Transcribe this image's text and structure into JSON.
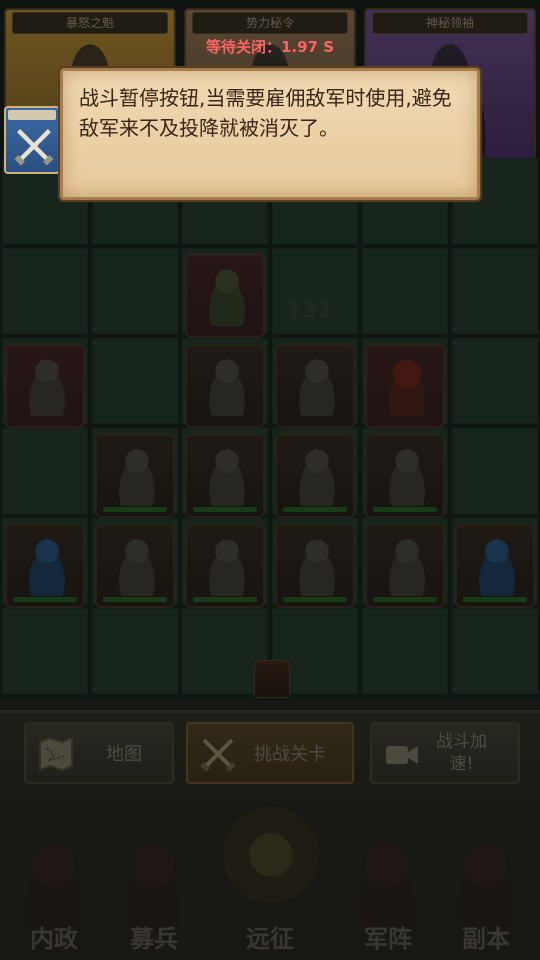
{
  "top_cards": [
    {
      "title": "暴怒之魁",
      "color": "#c99b3c"
    },
    {
      "title": "势力秘令",
      "color": "#9a7a5a"
    },
    {
      "title": "神秘领袖",
      "color": "#6a4b8a"
    }
  ],
  "battle": {
    "damage_number": "131"
  },
  "actions": {
    "map": "地图",
    "challenge": "挑战关卡",
    "speed_line1": "战斗加",
    "speed_line2": "速!"
  },
  "nav": {
    "items": [
      "内政",
      "募兵",
      "远征",
      "军阵",
      "副本"
    ]
  },
  "tutorial": {
    "timer": "等待关闭：1.97 S",
    "tooltip_text": "战斗暂停按钮,当需要雇佣敌军时使用,避免敌军来不及投降就被消灭了。"
  }
}
